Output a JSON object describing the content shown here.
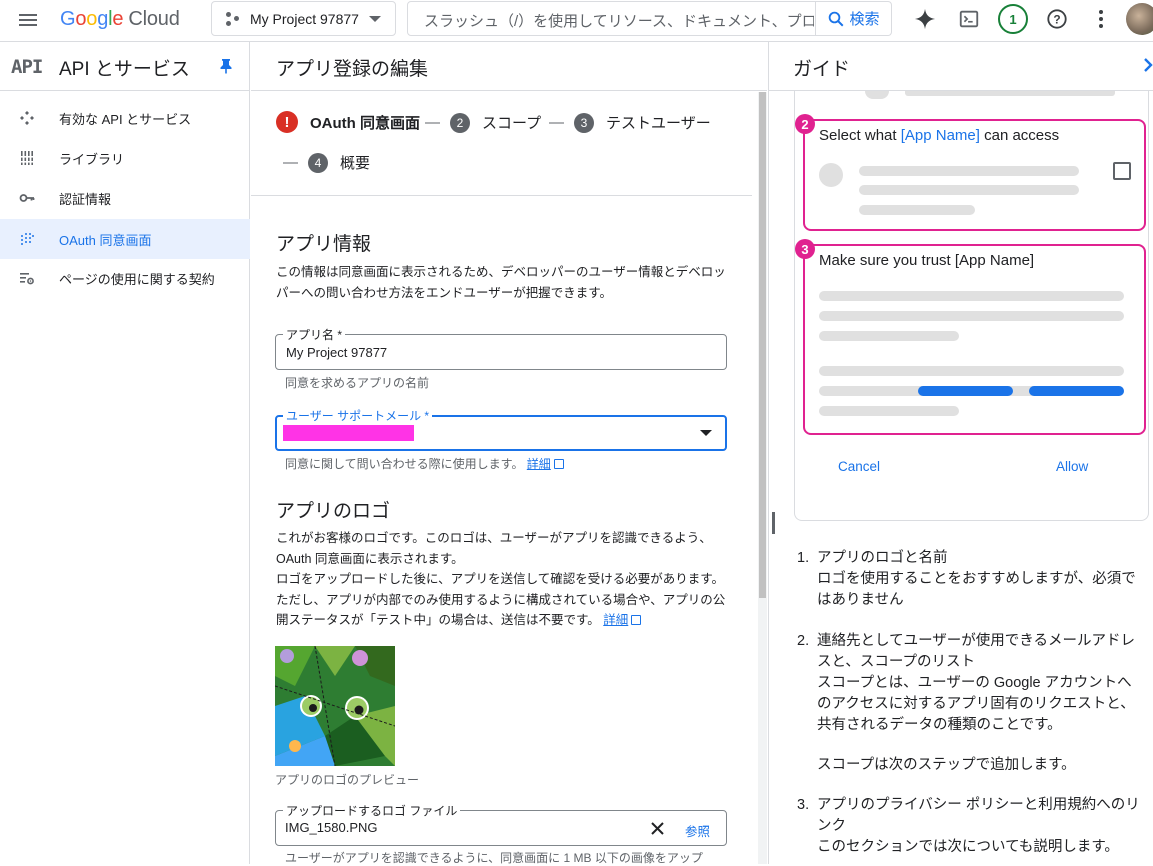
{
  "topbar": {
    "product": "Cloud",
    "project": "My Project 97877",
    "search_placeholder": "スラッシュ（/）を使用してリソース、ドキュメント、プロダクトなどを検索",
    "search_button": "検索",
    "notification_count": "1"
  },
  "sidebar": {
    "api_logo": "API",
    "title": "API とサービス",
    "items": [
      {
        "label": "有効な API とサービス",
        "icon": "api-services-icon"
      },
      {
        "label": "ライブラリ",
        "icon": "library-icon"
      },
      {
        "label": "認証情報",
        "icon": "key-icon"
      },
      {
        "label": "OAuth 同意画面",
        "icon": "oauth-consent-icon",
        "active": true
      },
      {
        "label": "ページの使用に関する契約",
        "icon": "page-usage-icon"
      }
    ]
  },
  "main": {
    "title": "アプリ登録の編集",
    "steps": [
      {
        "num": "!",
        "label": "OAuth 同意画面",
        "current": true
      },
      {
        "num": "2",
        "label": "スコープ"
      },
      {
        "num": "3",
        "label": "テストユーザー"
      },
      {
        "num": "4",
        "label": "概要"
      }
    ],
    "app_info": {
      "title": "アプリ情報",
      "desc": "この情報は同意画面に表示されるため、デベロッパーのユーザー情報とデベロッパーへの問い合わせ方法をエンドユーザーが把握できます。",
      "app_name_label": "アプリ名 *",
      "app_name_value": "My Project 97877",
      "app_name_hint": "同意を求めるアプリの名前",
      "support_email_label": "ユーザー サポートメール *",
      "support_email_hint": "同意に関して問い合わせる際に使用します。",
      "details_link": "詳細"
    },
    "app_logo": {
      "title": "アプリのロゴ",
      "desc1": "これがお客様のロゴです。このロゴは、ユーザーがアプリを認識できるよう、OAuth 同意画面に表示されます。",
      "desc2": "ロゴをアップロードした後に、アプリを送信して確認を受ける必要があります。ただし、アプリが内部でのみ使用するように構成されている場合や、アプリの公開ステータスが「テスト中」の場合は、送信は不要です。",
      "details_link": "詳細",
      "preview_caption": "アプリのロゴのプレビュー",
      "upload_label": "アップロードするロゴ ファイル",
      "upload_value": "IMG_1580.PNG",
      "browse_button": "参照",
      "upload_hint": "ユーザーがアプリを認識できるように、同意画面に 1 MB 以下の画像をアップ"
    }
  },
  "guide": {
    "title": "ガイド",
    "card2_prefix": "Select what ",
    "card2_app": "[App Name]",
    "card2_suffix": " can access",
    "card3_title": "Make sure you trust [App Name]",
    "card2_num": "2",
    "card3_num": "3",
    "cancel": "Cancel",
    "allow": "Allow",
    "items": [
      {
        "num": "1.",
        "title": "アプリのロゴと名前",
        "body": "ロゴを使用することをおすすめしますが、必須ではありません"
      },
      {
        "num": "2.",
        "title": "連絡先としてユーザーが使用できるメールアドレスと、スコープのリスト",
        "body": "スコープとは、ユーザーの Google アカウントへのアクセスに対するアプリ固有のリクエストと、共有されるデータの種類のことです。",
        "body2": "スコープは次のステップで追加します。"
      },
      {
        "num": "3.",
        "title": "アプリのプライバシー ポリシーと利用規約へのリンク",
        "body": "このセクションでは次についても説明します。"
      }
    ]
  },
  "colors": {
    "accent": "#1a73e8",
    "error": "#d93025",
    "guide_highlight": "#e02290",
    "redaction": "#ff33e6"
  }
}
